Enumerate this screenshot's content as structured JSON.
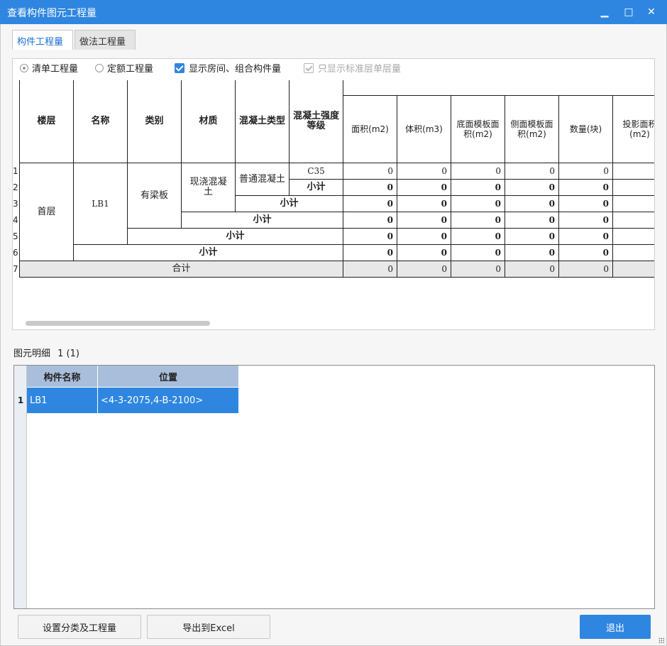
{
  "window": {
    "title": "查看构件图元工程量",
    "minimize_glyph": "▁",
    "maximize_glyph": "□",
    "close_glyph": "✕"
  },
  "tabs": [
    {
      "label": "构件工程量",
      "active": true
    },
    {
      "label": "做法工程量",
      "active": false
    }
  ],
  "options": {
    "radio_list": "清单工程量",
    "radio_quota": "定额工程量",
    "chk_show_room": "显示房间、组合构件量",
    "chk_std_floor": "只显示标准层单层量"
  },
  "table": {
    "headers": {
      "floor": "楼层",
      "name": "名称",
      "category": "类别",
      "material": "材质",
      "concrete_type": "混凝土类型",
      "concrete_grade": "混凝土强度等级",
      "area": "面积(m2)",
      "volume": "体积(m3)",
      "bottom_form": "底面模板面积(m2)",
      "side_form": "侧面模板面积(m2)",
      "count": "数量(块)",
      "proj_area": "投影面积(m2)"
    },
    "row_numbers": [
      "1",
      "2",
      "3",
      "4",
      "5",
      "6",
      "7"
    ],
    "merged": {
      "floor": "首层",
      "name": "LB1",
      "category": "有梁板",
      "material": "现浇混凝土",
      "concrete_type": "普通混凝土",
      "concrete_grade": "C35"
    },
    "subtotal_label": "小计",
    "total_label": "合计",
    "rows": [
      {
        "area": "0",
        "volume": "0",
        "bottom_form": "0",
        "side_form": "0",
        "count": "0"
      },
      {
        "area": "0",
        "volume": "0",
        "bottom_form": "0",
        "side_form": "0",
        "count": "0"
      },
      {
        "area": "0",
        "volume": "0",
        "bottom_form": "0",
        "side_form": "0",
        "count": "0"
      },
      {
        "area": "0",
        "volume": "0",
        "bottom_form": "0",
        "side_form": "0",
        "count": "0"
      },
      {
        "area": "0",
        "volume": "0",
        "bottom_form": "0",
        "side_form": "0",
        "count": "0"
      },
      {
        "area": "0",
        "volume": "0",
        "bottom_form": "0",
        "side_form": "0",
        "count": "0"
      },
      {
        "area": "0",
        "volume": "0",
        "bottom_form": "0",
        "side_form": "0",
        "count": "0"
      }
    ]
  },
  "detail": {
    "label": "图元明细",
    "count": "1 (1)",
    "columns": [
      "构件名称",
      "位置"
    ],
    "rows": [
      {
        "index": "1",
        "name": "LB1",
        "position": "<4-3-2075,4-B-2100>"
      }
    ]
  },
  "buttons": {
    "settings": "设置分类及工程量",
    "export": "导出到Excel",
    "exit": "退出"
  },
  "colors": {
    "accent": "#2f86e0",
    "header_blue": "#a9bedb"
  }
}
